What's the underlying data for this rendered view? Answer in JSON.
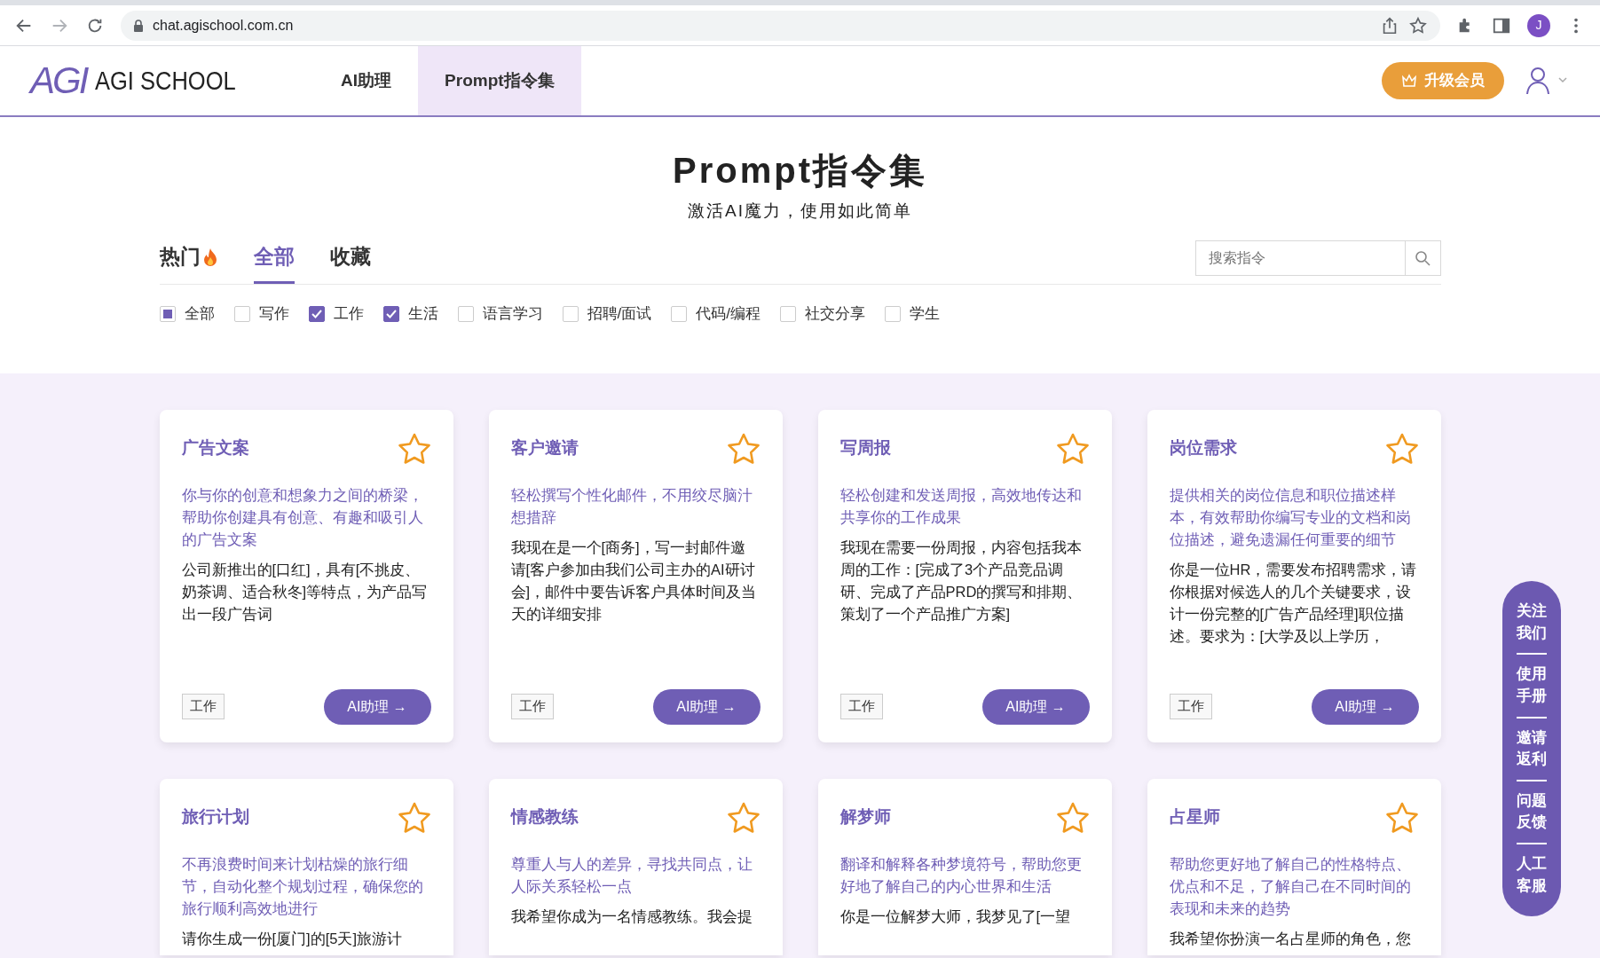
{
  "browser": {
    "url": "chat.agischool.com.cn",
    "profile_initial": "J"
  },
  "header": {
    "logo_mark": "AGI",
    "logo_text": "AGI SCHOOL",
    "nav": [
      {
        "label": "AI助理",
        "selected": false
      },
      {
        "label": "Prompt指令集",
        "selected": true
      }
    ],
    "upgrade_button": "升级会员"
  },
  "hero": {
    "title": "Prompt指令集",
    "subtitle": "激活AI魔力，使用如此简单"
  },
  "tabs": [
    {
      "label": "热门",
      "selected": false,
      "hot": true
    },
    {
      "label": "全部",
      "selected": true,
      "hot": false
    },
    {
      "label": "收藏",
      "selected": false,
      "hot": false
    }
  ],
  "search": {
    "placeholder": "搜索指令"
  },
  "filters": [
    {
      "label": "全部",
      "kind": "select-all",
      "checked": true
    },
    {
      "label": "写作",
      "kind": "option",
      "checked": false
    },
    {
      "label": "工作",
      "kind": "option",
      "checked": true
    },
    {
      "label": "生活",
      "kind": "option",
      "checked": true
    },
    {
      "label": "语言学习",
      "kind": "option",
      "checked": false
    },
    {
      "label": "招聘/面试",
      "kind": "option",
      "checked": false
    },
    {
      "label": "代码/编程",
      "kind": "option",
      "checked": false
    },
    {
      "label": "社交分享",
      "kind": "option",
      "checked": false
    },
    {
      "label": "学生",
      "kind": "option",
      "checked": false
    }
  ],
  "cards": [
    {
      "title": "广告文案",
      "favorite": false,
      "description": "你与你的创意和想象力之间的桥梁，帮助你创建具有创意、有趣和吸引人的广告文案",
      "prompt": "公司新推出的[口红]，具有[不挑皮、奶茶调、适合秋冬]等特点，为产品写出一段广告词",
      "tag": "工作",
      "button": "AI助理 →"
    },
    {
      "title": "客户邀请",
      "favorite": false,
      "description": "轻松撰写个性化邮件，不用绞尽脑汁想措辞",
      "prompt": "我现在是一个[商务]，写一封邮件邀请[客户参加由我们公司主办的AI研讨会]，邮件中要告诉客户具体时间及当天的详细安排",
      "tag": "工作",
      "button": "AI助理 →"
    },
    {
      "title": "写周报",
      "favorite": false,
      "description": "轻松创建和发送周报，高效地传达和共享你的工作成果",
      "prompt": "我现在需要一份周报，内容包括我本周的工作：[完成了3个产品竞品调研、完成了产品PRD的撰写和排期、策划了一个产品推广方案]",
      "tag": "工作",
      "button": "AI助理 →"
    },
    {
      "title": "岗位需求",
      "favorite": false,
      "description": "提供相关的岗位信息和职位描述样本，有效帮助你编写专业的文档和岗位描述，避免遗漏任何重要的细节",
      "prompt": "你是一位HR，需要发布招聘需求，请你根据对候选人的几个关键要求，设计一份完整的[广告产品经理]职位描述。要求为：[大学及以上学历，",
      "tag": "工作",
      "button": "AI助理 →"
    },
    {
      "title": "旅行计划",
      "favorite": false,
      "description": "不再浪费时间来计划枯燥的旅行细节，自动化整个规划过程，确保您的旅行顺利高效地进行",
      "prompt": "请你生成一份[厦门]的[5天]旅游计"
    },
    {
      "title": "情感教练",
      "favorite": false,
      "description": "尊重人与人的差异，寻找共同点，让人际关系轻松一点",
      "prompt": "我希望你成为一名情感教练。我会提"
    },
    {
      "title": "解梦师",
      "favorite": false,
      "description": "翻译和解释各种梦境符号，帮助您更好地了解自己的内心世界和生活",
      "prompt": "你是一位解梦大师，我梦见了[一望"
    },
    {
      "title": "占星师",
      "favorite": false,
      "description": "帮助您更好地了解自己的性格特点、优点和不足，了解自己在不同时间的表现和未来的趋势",
      "prompt": "我希望你扮演一名占星师的角色，您"
    }
  ],
  "side_menu": [
    "关注我们",
    "使用手册",
    "邀请返利",
    "问题反馈",
    "人工客服"
  ]
}
